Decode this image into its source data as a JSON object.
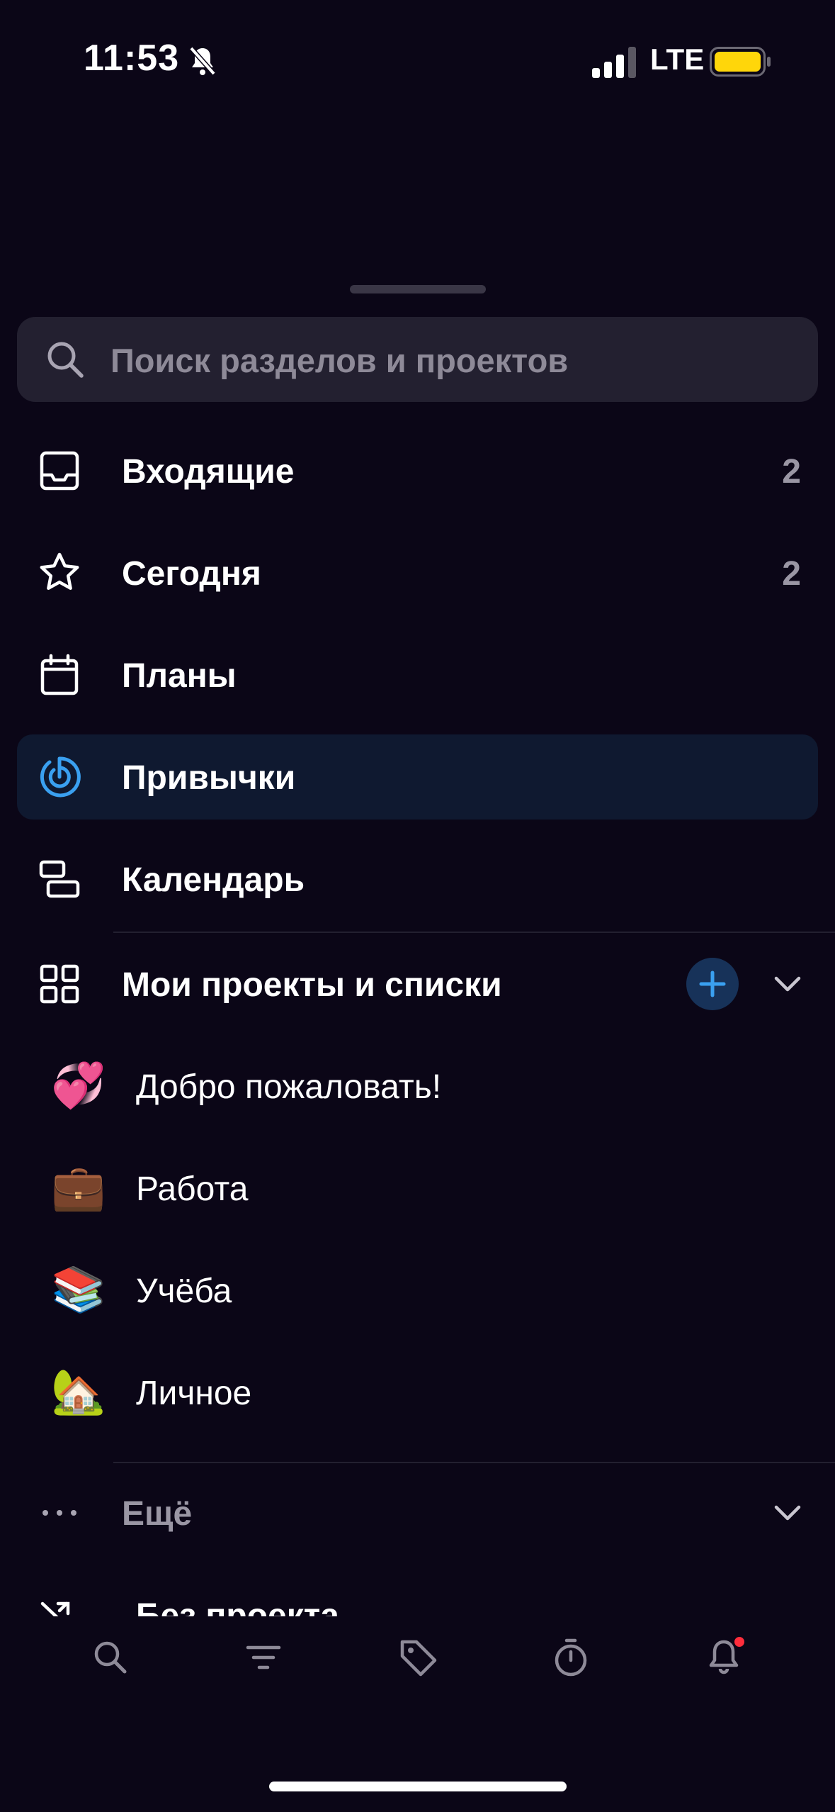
{
  "status_bar": {
    "time": "11:53",
    "network": "LTE",
    "battery_color": "#ffd60a"
  },
  "search": {
    "placeholder": "Поиск разделов и проектов"
  },
  "nav": [
    {
      "label": "Входящие",
      "count": "2",
      "icon": "inbox-icon"
    },
    {
      "label": "Сегодня",
      "count": "2",
      "icon": "star-icon"
    },
    {
      "label": "Планы",
      "count": "",
      "icon": "calendar-icon"
    },
    {
      "label": "Привычки",
      "count": "",
      "icon": "habit-target-icon",
      "active": true
    },
    {
      "label": "Календарь",
      "count": "",
      "icon": "schedule-blocks-icon"
    }
  ],
  "projects_section": {
    "label": "Мои проекты и списки",
    "items": [
      {
        "emoji": "💞",
        "label": "Добро пожаловать!"
      },
      {
        "emoji": "💼",
        "label": "Работа"
      },
      {
        "emoji": "📚",
        "label": "Учёба"
      },
      {
        "emoji": "🏡",
        "label": "Личное"
      }
    ]
  },
  "more": {
    "label": "Ещё"
  },
  "partial_item": {
    "label": "Без проекта"
  },
  "tabbar": [
    "search-icon",
    "filter-icon",
    "tag-icon",
    "timer-icon",
    "bell-icon"
  ],
  "colors": {
    "background": "#0b0617",
    "accent": "#3aa0f0",
    "active_row": "#0f1930",
    "badge_red": "#ff2d3c"
  }
}
